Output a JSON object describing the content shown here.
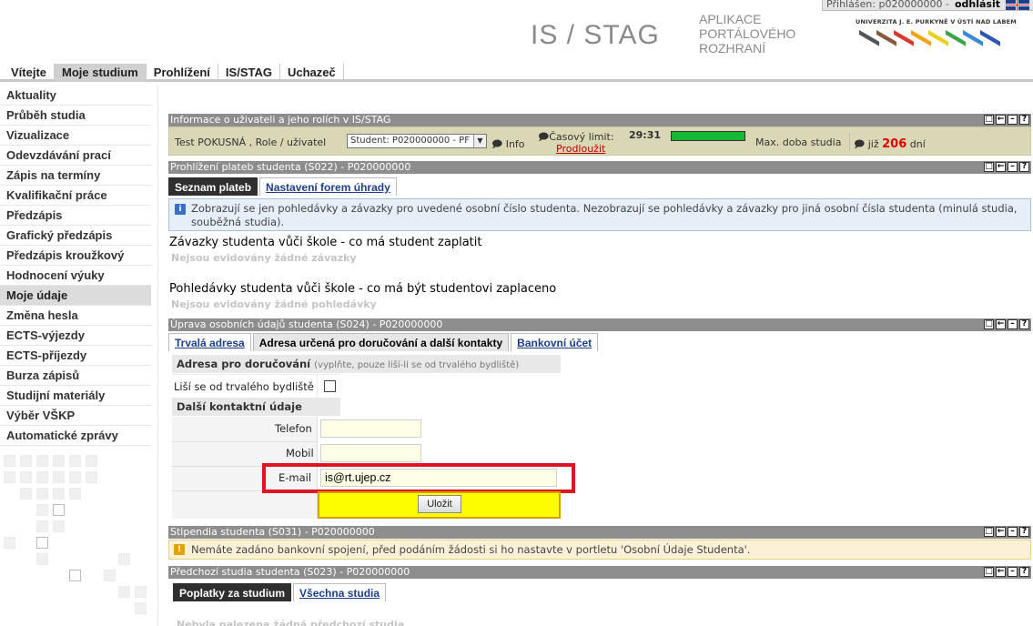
{
  "header": {
    "login_text": "Přihlášen: p020000000 -",
    "logout_label": "odhlásit",
    "app_title": "IS / STAG",
    "app_sub_line1": "APLIKACE",
    "app_sub_line2": "PORTÁLOVÉHO",
    "app_sub_line3": "ROZHRANÍ",
    "logo_text": "UNIVERZITA J. E. PURKYNĚ V ÚSTÍ NAD LABEM",
    "logo_colors": [
      "#555555",
      "#8a5a3c",
      "#d83a2e",
      "#f2a30f",
      "#e7d11c",
      "#3da64a",
      "#3a8ad8",
      "#2b56b5"
    ]
  },
  "topnav": {
    "tabs": [
      "Vítejte",
      "Moje studium",
      "Prohlížení",
      "IS/STAG",
      "Uchazeč"
    ],
    "active_index": 1
  },
  "sidemenu": {
    "items": [
      "Aktuality",
      "Průběh studia",
      "Vizualizace",
      "Odevzdávání prací",
      "Zápis na termíny",
      "Kvalifikační práce",
      "Předzápis",
      "Grafický předzápis",
      "Předzápis kroužkový",
      "Hodnocení výuky",
      "Moje údaje",
      "Změna hesla",
      "ECTS-výjezdy",
      "ECTS-příjezdy",
      "Burza zápisů",
      "Studijní materiály",
      "Výběr VŠKP",
      "Automatické zprávy"
    ],
    "active_index": 10
  },
  "portlet_info": {
    "title": "Informace o uživateli a jeho rolích v IS/STAG",
    "user_text": "Test POKUSNÁ , Role / uživatel",
    "select_value": "Student: P020000000 - PF",
    "info_label": "Info",
    "limit_label": "Časový limit:",
    "time_value": "29:31",
    "time_progress": 1.0,
    "extend_label": "Prodloužit",
    "max_label": "Max. doba studia",
    "already_label": "již",
    "days_value": "206",
    "days_unit": "dní"
  },
  "portlet_payments": {
    "title": "Prohlížení plateb studenta (S022) - P020000000",
    "tab_active": "Seznam plateb",
    "tab_other": "Nastavení forem úhrady",
    "notice": "Zobrazují se jen pohledávky a závazky pro uvedené osobní číslo studenta. Nezobrazují se pohledávky a závazky pro jiná osobní čísla studenta (minulá studia, souběžná studia).",
    "section1_title": "Závazky studenta vůči škole - co má student zaplatit",
    "section1_empty": "Nejsou evidovány žádné závazky",
    "section2_title": "Pohledávky studenta vůči škole - co má být studentovi zaplaceno",
    "section2_empty": "Nejsou evidovány žádné pohledávky"
  },
  "portlet_personal": {
    "title": "Úprava osobních údajů studenta (S024) - P020000000",
    "tab1": "Trvalá adresa",
    "tab2": "Adresa určená pro doručování a další kontakty",
    "tab3": "Bankovní účet",
    "delivery_head": "Adresa pro doručování",
    "delivery_hint": "(vyplňte, pouze liší-li se od trvalého bydliště)",
    "differs_label": "Liší se od trvalého bydliště",
    "contacts_head": "Další kontaktní údaje",
    "phone_label": "Telefon",
    "phone_value": "",
    "mobile_label": "Mobil",
    "mobile_value": "",
    "email_label": "E-mail",
    "email_value": "is@rt.ujep.cz",
    "save_label": "Uložit"
  },
  "portlet_stipend": {
    "title": "Stipendia studenta (S031) - P020000000",
    "warning": "Nemáte zadáno bankovní spojení, před podáním žádosti si ho nastavte v portletu 'Osobní Údaje Studenta'."
  },
  "portlet_prev": {
    "title": "Předchozí studia studenta (S023) - P020000000",
    "tab_active": "Poplatky za studium",
    "tab_other": "Všechna studia",
    "empty_text": "Nebyla nalezena žádná předchozí studia"
  },
  "portlet_icons": [
    "□",
    "←",
    "–",
    "?"
  ]
}
